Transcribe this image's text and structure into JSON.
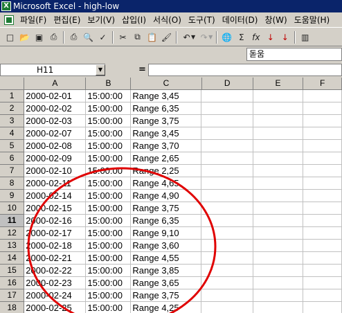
{
  "window": {
    "title": "Microsoft Excel - high-low",
    "app_icon": "excel-icon"
  },
  "menu": [
    "파일(F)",
    "편집(E)",
    "보기(V)",
    "삽입(I)",
    "서식(O)",
    "도구(T)",
    "데이터(D)",
    "창(W)",
    "도움말(H)"
  ],
  "toolbar": {
    "buttons": [
      {
        "name": "new-icon",
        "glyph": "□"
      },
      {
        "name": "open-icon",
        "glyph": "📂"
      },
      {
        "name": "save-icon",
        "glyph": "▣"
      },
      {
        "name": "print-preview-icon",
        "glyph": "⎙"
      },
      {
        "name": "print-icon",
        "glyph": "⎙"
      },
      {
        "name": "preview-icon",
        "glyph": "🔍"
      },
      {
        "name": "spelling-icon",
        "glyph": "✓"
      },
      {
        "name": "cut-icon",
        "glyph": "✂"
      },
      {
        "name": "copy-icon",
        "glyph": "⧉"
      },
      {
        "name": "paste-icon",
        "glyph": "📋"
      },
      {
        "name": "format-painter-icon",
        "glyph": "🖌"
      },
      {
        "name": "undo-icon",
        "glyph": "↶"
      },
      {
        "name": "redo-icon",
        "glyph": "↷"
      },
      {
        "name": "hyperlink-icon",
        "glyph": "🌐"
      },
      {
        "name": "autosum-icon",
        "glyph": "Σ"
      },
      {
        "name": "function-icon",
        "glyph": "fx"
      },
      {
        "name": "sort-ascending-icon",
        "glyph": "↓"
      },
      {
        "name": "sort-descending-icon",
        "glyph": "↓"
      },
      {
        "name": "chart-wizard-icon",
        "glyph": "▥"
      }
    ],
    "font_name": "돋움"
  },
  "formula_bar": {
    "name_box": "H11",
    "equals": "=",
    "formula": ""
  },
  "sheet": {
    "columns": [
      "A",
      "B",
      "C",
      "D",
      "E",
      "F"
    ],
    "active_row": "11",
    "rows": [
      {
        "n": "1",
        "a": "2000-02-01",
        "b": "15:00:00",
        "c": "Range 3,45"
      },
      {
        "n": "2",
        "a": "2000-02-02",
        "b": "15:00:00",
        "c": "Range 6,35"
      },
      {
        "n": "3",
        "a": "2000-02-03",
        "b": "15:00:00",
        "c": "Range 3,75"
      },
      {
        "n": "4",
        "a": "2000-02-07",
        "b": "15:00:00",
        "c": "Range 3,45"
      },
      {
        "n": "5",
        "a": "2000-02-08",
        "b": "15:00:00",
        "c": "Range 3,70"
      },
      {
        "n": "6",
        "a": "2000-02-09",
        "b": "15:00:00",
        "c": "Range 2,65"
      },
      {
        "n": "7",
        "a": "2000-02-10",
        "b": "15:00:00",
        "c": "Range 2,25"
      },
      {
        "n": "8",
        "a": "2000-02-11",
        "b": "15:00:00",
        "c": "Range 4,65"
      },
      {
        "n": "9",
        "a": "2000-02-14",
        "b": "15:00:00",
        "c": "Range 4,90"
      },
      {
        "n": "10",
        "a": "2000-02-15",
        "b": "15:00:00",
        "c": "Range 3,75"
      },
      {
        "n": "11",
        "a": "2000-02-16",
        "b": "15:00:00",
        "c": "Range 6,35"
      },
      {
        "n": "12",
        "a": "2000-02-17",
        "b": "15:00:00",
        "c": "Range 9,10"
      },
      {
        "n": "13",
        "a": "2000-02-18",
        "b": "15:00:00",
        "c": "Range 3,60"
      },
      {
        "n": "14",
        "a": "2000-02-21",
        "b": "15:00:00",
        "c": "Range 4,55"
      },
      {
        "n": "15",
        "a": "2000-02-22",
        "b": "15:00:00",
        "c": "Range 3,85"
      },
      {
        "n": "16",
        "a": "2000-02-23",
        "b": "15:00:00",
        "c": "Range 3,65"
      },
      {
        "n": "17",
        "a": "2000-02-24",
        "b": "15:00:00",
        "c": "Range 3,75"
      },
      {
        "n": "18",
        "a": "2000-02-25",
        "b": "15:00:00",
        "c": "Range 4,25"
      }
    ]
  },
  "annotation": {
    "circle_color": "#e00000"
  }
}
